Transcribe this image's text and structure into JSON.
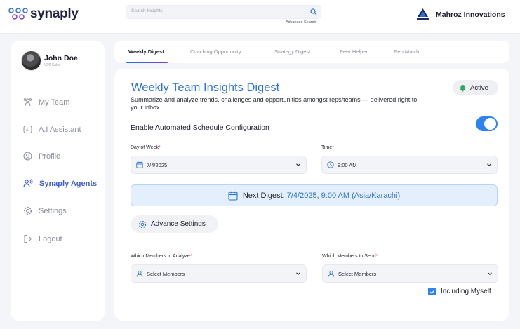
{
  "brand": {
    "name": "synaply"
  },
  "search": {
    "placeholder": "Search Insights",
    "advanced_link": "Advanced Search"
  },
  "company": {
    "name": "Mahroz Innovations",
    "logo_text": "COMPANY"
  },
  "user": {
    "name": "John Doe",
    "role": "VP0 Sales"
  },
  "sidebar": {
    "items": [
      {
        "label": "My Team",
        "icon": "team-icon",
        "active": false
      },
      {
        "label": "A.I Assistant",
        "icon": "ai-icon",
        "active": false
      },
      {
        "label": "Profile",
        "icon": "profile-icon",
        "active": false
      },
      {
        "label": "Synaply Agents",
        "icon": "agents-icon",
        "active": true
      },
      {
        "label": "Settings",
        "icon": "gear-icon",
        "active": false
      },
      {
        "label": "Logout",
        "icon": "logout-icon",
        "active": false
      }
    ]
  },
  "tabs": [
    {
      "label": "Weekly Digest",
      "active": true
    },
    {
      "label": "Coaching Opportunity",
      "active": false
    },
    {
      "label": "Strategy Digest",
      "active": false
    },
    {
      "label": "Peer Helper",
      "active": false
    },
    {
      "label": "Rep Match",
      "active": false
    }
  ],
  "digest": {
    "title": "Weekly Team Insights Digest",
    "description": "Summarize and analyze trends, challenges and opportunities amongst reps/teams — delivered right to your inbox",
    "status": "Active",
    "schedule_label": "Enable Automated Schedule Configuration",
    "schedule_enabled": true,
    "day_label": "Day of Week",
    "day_value": "7/4/2025",
    "time_label": "Time",
    "time_value": "9:00 AM",
    "next_prefix": "Next Digest:",
    "next_value": "7/4/2025, 9:00 AM (Asia/Karachi)",
    "advance_button": "Advance Settings",
    "analyze_label": "Which Members to Analyze",
    "analyze_placeholder": "Select Members",
    "send_label": "Which Members to Send",
    "send_placeholder": "Select Members",
    "include_myself_label": "Including Myself",
    "include_myself_checked": true,
    "required_mark": "*"
  },
  "colors": {
    "accent": "#2e73d6",
    "toggle": "#2d83f0",
    "nav_active": "#3d5fd6",
    "required": "#e0453c"
  }
}
